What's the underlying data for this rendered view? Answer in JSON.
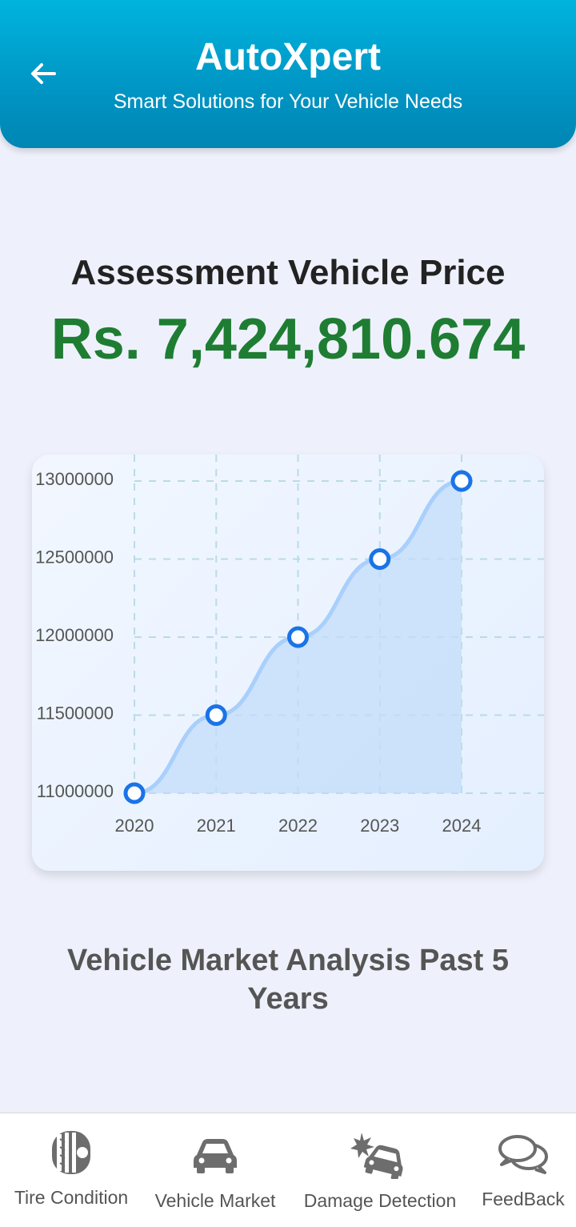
{
  "header": {
    "title": "AutoXpert",
    "subtitle": "Smart Solutions for Your Vehicle Needs",
    "back_icon": "arrow-left-icon"
  },
  "assessment": {
    "title": "Assessment Vehicle Price",
    "price": "Rs. 7,424,810.674"
  },
  "chart_data": {
    "type": "line",
    "x": [
      "2020",
      "2021",
      "2022",
      "2023",
      "2024"
    ],
    "series": [
      {
        "values": [
          11000000,
          11500000,
          12000000,
          12500000,
          13000000
        ]
      }
    ],
    "yticks": [
      "11000000",
      "11500000",
      "12000000",
      "12500000",
      "13000000"
    ],
    "ylim": [
      11000000,
      13000000
    ],
    "grid": true,
    "fill": "area",
    "line_color": "#a9cffb",
    "point_color": "#1a73e8"
  },
  "analysis_caption": "Vehicle Market Analysis Past 5 Years",
  "nav": {
    "items": [
      {
        "label": "Tire Condition",
        "icon": "tire-icon"
      },
      {
        "label": "Vehicle Market",
        "icon": "car-icon"
      },
      {
        "label": "Damage Detection",
        "icon": "car-crash-icon"
      },
      {
        "label": "FeedBack",
        "icon": "chat-bubbles-icon"
      }
    ]
  }
}
